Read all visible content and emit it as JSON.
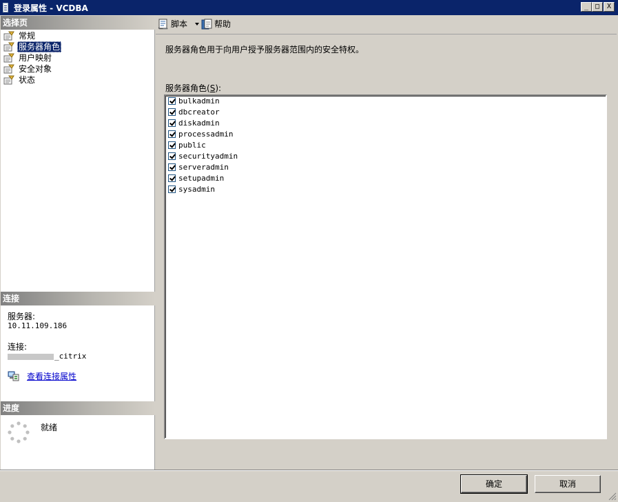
{
  "window": {
    "title": "登录属性 - VCDBA",
    "minimize_glyph": "_",
    "maximize_glyph": "□",
    "close_glyph": "X"
  },
  "left_pane": {
    "select_page_header": "选择页",
    "pages": [
      {
        "label": "常规",
        "icon": "page-icon",
        "selected": false
      },
      {
        "label": "服务器角色",
        "icon": "page-icon",
        "selected": true
      },
      {
        "label": "用户映射",
        "icon": "page-icon",
        "selected": false
      },
      {
        "label": "安全对象",
        "icon": "page-icon",
        "selected": false
      },
      {
        "label": "状态",
        "icon": "page-icon",
        "selected": false
      }
    ],
    "connection_header": "连接",
    "server_label": "服务器:",
    "server_value": "10.11.109.186",
    "connection_label": "连接:",
    "connection_value_suffix": "_citrix",
    "view_connection_link": "查看连接属性",
    "progress_header": "进度",
    "progress_status": "就绪"
  },
  "toolbar": {
    "script_label": "脚本",
    "help_label": "帮助"
  },
  "main": {
    "description": "服务器角色用于向用户授予服务器范围内的安全特权。",
    "roles_label_prefix": "服务器角色",
    "roles_label_access": "S",
    "roles_label_suffix": ":",
    "roles": [
      {
        "name": "bulkadmin",
        "checked": true
      },
      {
        "name": "dbcreator",
        "checked": true
      },
      {
        "name": "diskadmin",
        "checked": true
      },
      {
        "name": "processadmin",
        "checked": true
      },
      {
        "name": "public",
        "checked": true
      },
      {
        "name": "securityadmin",
        "checked": true
      },
      {
        "name": "serveradmin",
        "checked": true
      },
      {
        "name": "setupadmin",
        "checked": true
      },
      {
        "name": "sysadmin",
        "checked": true
      }
    ]
  },
  "buttons": {
    "ok": "确定",
    "cancel": "取消"
  },
  "colors": {
    "title_bar": "#0a246a",
    "selection": "#0a246a",
    "link": "#0000cc"
  }
}
